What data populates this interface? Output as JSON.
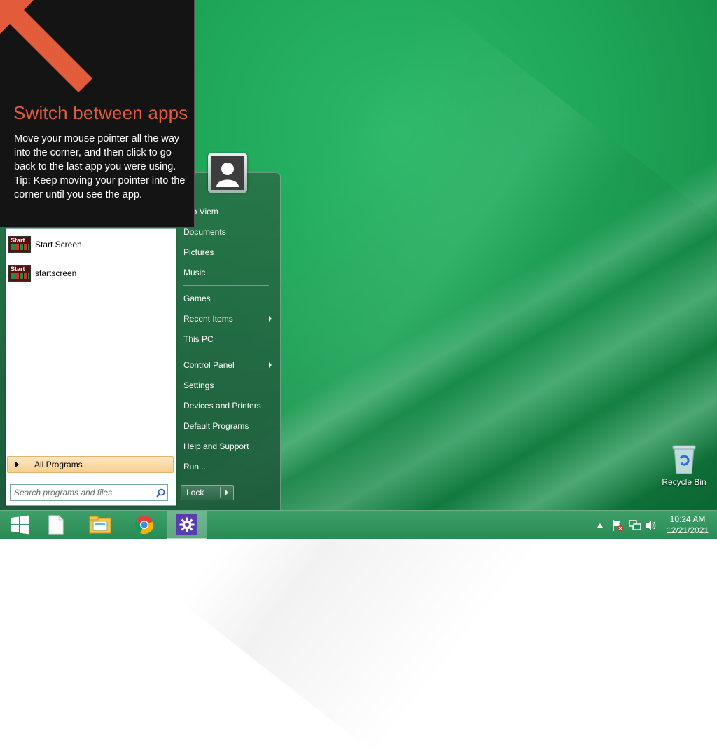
{
  "tooltip": {
    "title": "Switch between apps",
    "body": "Move your mouse pointer all the way into the corner, and then click to go back to the last app you were using.\nTip: Keep moving your pointer into the corner until you see the app."
  },
  "start_menu": {
    "programs": [
      {
        "label": "Start Screen",
        "icon_text": "Start"
      },
      {
        "label": "startscreen",
        "icon_text": "Start"
      }
    ],
    "all_programs_label": "All Programs",
    "search_placeholder": "Search programs and files",
    "right_items": [
      {
        "label": "Jub Viem"
      },
      {
        "label": "Documents"
      },
      {
        "label": "Pictures"
      },
      {
        "label": "Music"
      },
      {
        "label": "Games"
      },
      {
        "label": "Recent Items"
      },
      {
        "label": "This PC"
      },
      {
        "label": "Control Panel"
      },
      {
        "label": "Settings"
      },
      {
        "label": "Devices and Printers"
      },
      {
        "label": "Default Programs"
      },
      {
        "label": "Help and Support"
      },
      {
        "label": "Run..."
      }
    ],
    "lock_label": "Lock"
  },
  "desktop": {
    "recycle_bin_label": "Recycle Bin"
  },
  "taskbar": {
    "clock_time": "10:24 AM",
    "clock_date": "12/21/2021"
  },
  "icons": {
    "start": "windows-logo-icon",
    "file": "document-icon",
    "explorer": "file-explorer-icon",
    "browser": "chrome-icon",
    "settings": "gear-icon"
  },
  "colors": {
    "accent_orange": "#e25b3a",
    "desktop_green": "#1ea558"
  }
}
